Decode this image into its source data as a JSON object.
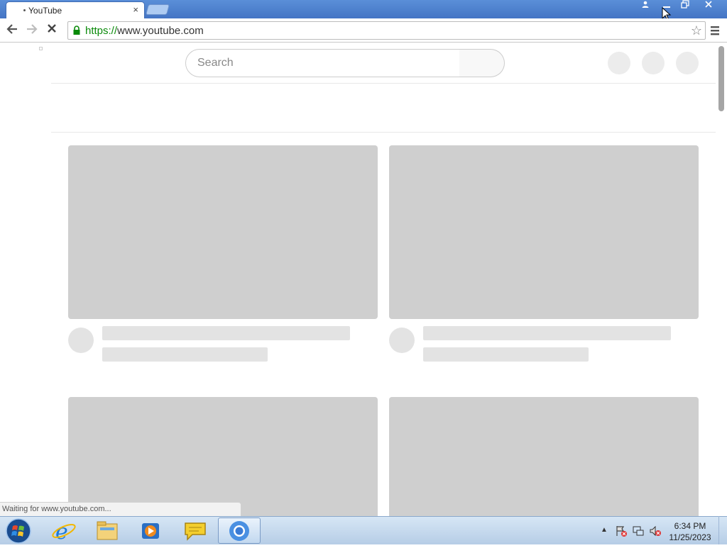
{
  "browser": {
    "tab_title": "YouTube",
    "tab_close": "×",
    "url_scheme": "https://",
    "url_host": "www.youtube.com",
    "status_text": "Waiting for www.youtube.com..."
  },
  "window_controls": {
    "profile": "👤",
    "minimize": "—",
    "maximize": "❐",
    "close": "✕"
  },
  "nav": {
    "back": "←",
    "forward": "→",
    "stop": "✕",
    "star": "☆"
  },
  "youtube": {
    "search_placeholder": "Search"
  },
  "taskbar": {
    "time": "6:34 PM",
    "date": "11/25/2023",
    "tray_arrow": "▲",
    "pinned": [
      "internet-explorer",
      "file-explorer",
      "media-player",
      "chat",
      "chrome"
    ]
  },
  "colors": {
    "titlebar": "#4a7fd0",
    "skeleton_thumb": "#cfcfcf",
    "skeleton_line": "#e3e3e3",
    "url_scheme": "#0a8a0a"
  }
}
